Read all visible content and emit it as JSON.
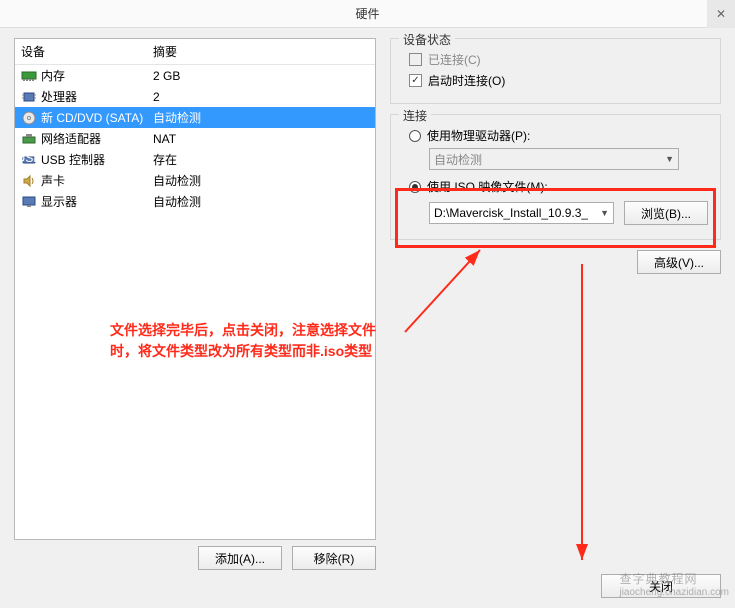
{
  "window": {
    "title": "硬件",
    "close_glyph": "✕"
  },
  "hwlist": {
    "header_device": "设备",
    "header_summary": "摘要",
    "rows": [
      {
        "name": "内存",
        "summary": "2 GB",
        "icon": "memory-icon"
      },
      {
        "name": "处理器",
        "summary": "2",
        "icon": "cpu-icon"
      },
      {
        "name": "新 CD/DVD (SATA)",
        "summary": "自动检测",
        "icon": "cd-icon",
        "selected": true
      },
      {
        "name": "网络适配器",
        "summary": "NAT",
        "icon": "network-icon"
      },
      {
        "name": "USB 控制器",
        "summary": "存在",
        "icon": "usb-icon"
      },
      {
        "name": "声卡",
        "summary": "自动检测",
        "icon": "sound-icon"
      },
      {
        "name": "显示器",
        "summary": "自动检测",
        "icon": "display-icon"
      }
    ],
    "add_label": "添加(A)...",
    "remove_label": "移除(R)"
  },
  "status": {
    "legend": "设备状态",
    "connected_label": "已连接(C)",
    "connect_on_label": "启动时连接(O)"
  },
  "connection": {
    "legend": "连接",
    "physical_label": "使用物理驱动器(P):",
    "physical_value": "自动检测",
    "iso_label": "使用 ISO 映像文件(M):",
    "iso_path": "D:\\Mavercisk_Install_10.9.3_",
    "browse_label": "浏览(B)..."
  },
  "advanced_label": "高级(V)...",
  "annotation": "文件选择完毕后，点击关闭，注意选择文件时，将文件类型改为所有类型而非.iso类型",
  "close_label": "关闭",
  "watermark": {
    "line1": "查字典教程网",
    "line2": "jiaocheng.chazidian.com"
  }
}
